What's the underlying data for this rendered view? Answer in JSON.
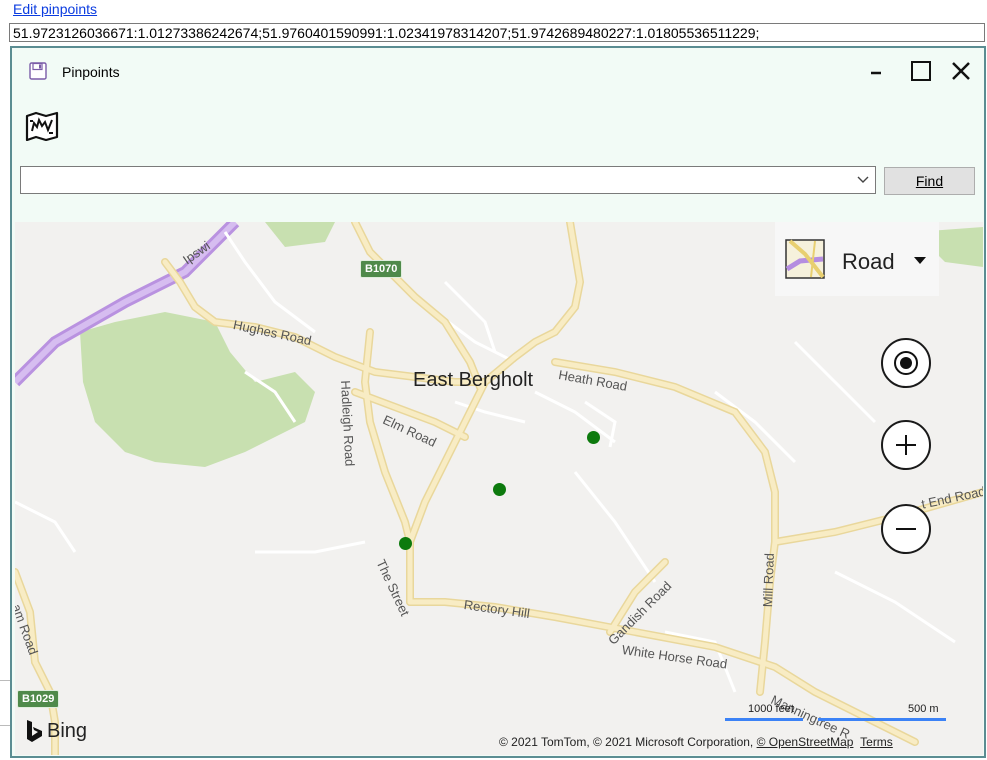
{
  "page": {
    "link_label": "Edit pinpoints",
    "coordinates_value": "51.9723126036671:1.01273386242674;51.9760401590991:1.02341978314207;51.9742689480227:1.01805536511229;"
  },
  "dialog": {
    "title": "Pinpoints",
    "search_value": "",
    "find_label": "Find"
  },
  "map": {
    "style_label": "Road",
    "town_label": "East Bergholt",
    "road_labels": {
      "ipswich": "Ipswi",
      "hughes": "Hughes Road",
      "heath": "Heath Road",
      "elm": "Elm Road",
      "hadleigh": "Hadleigh Road",
      "the_street": "The Street",
      "rectory": "Rectory Hill",
      "gandish": "Gandish Road",
      "white_horse": "White Horse Road",
      "mill": "Mill Road",
      "end": "t End Road",
      "left_road": "am Road",
      "manningtree": "Manningtree R"
    },
    "badges": {
      "b1070": "B1070",
      "b1029": "B1029"
    },
    "brand": "Bing",
    "scale_feet": "1000 feet",
    "scale_m": "500 m",
    "copyright_text": "© 2021 TomTom, © 2021 Microsoft Corporation, ",
    "osm_link": "© OpenStreetMap",
    "terms_link": "Terms",
    "pins": [
      {
        "lat": 51.9723126036671,
        "lon": 1.01273386242674
      },
      {
        "lat": 51.9760401590991,
        "lon": 1.02341978314207
      },
      {
        "lat": 51.9742689480227,
        "lon": 1.01805536511229
      }
    ]
  },
  "colors": {
    "dialog_bg": "#f2fbf6",
    "dialog_border": "#5b8d92",
    "pin": "#0d7a0d",
    "road": "#f5e7b3",
    "green_area": "#c8e0b0",
    "motorway": "#c9a6e8",
    "scale_bar": "#3b82f6"
  }
}
